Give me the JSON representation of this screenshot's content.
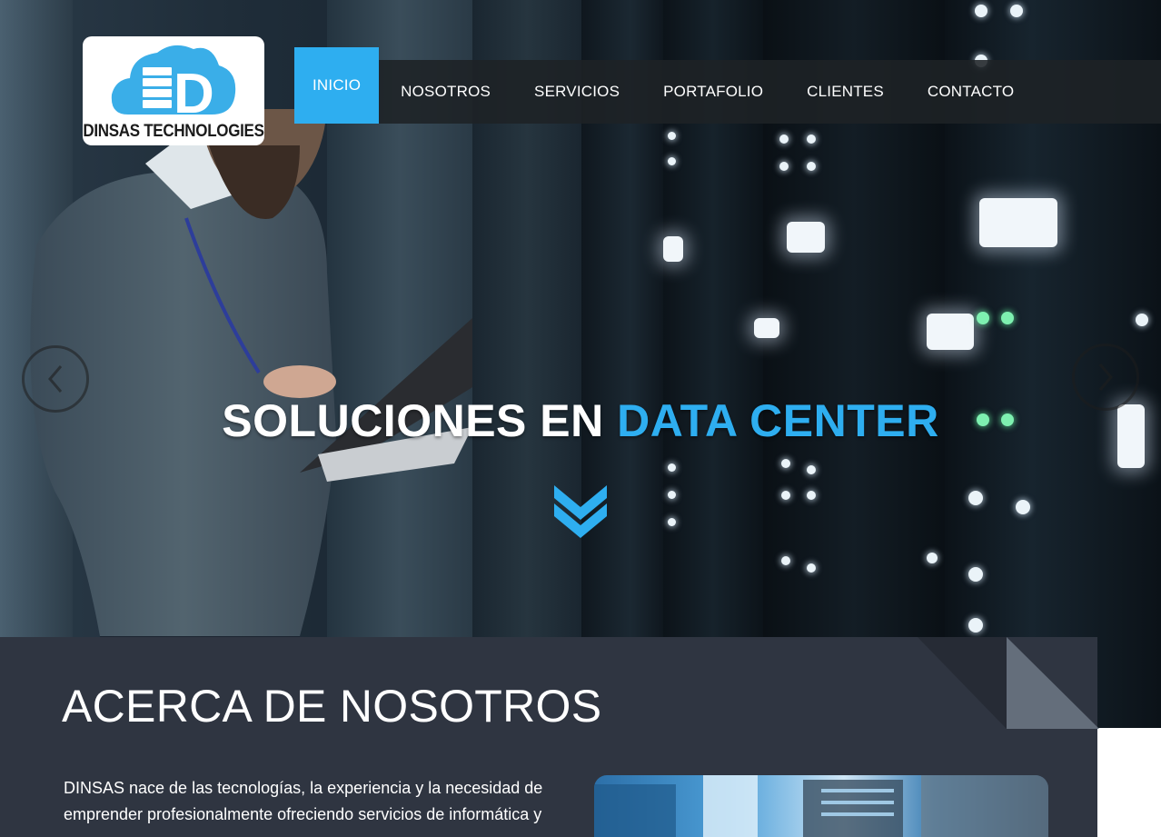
{
  "brand": {
    "logo_letter": "D",
    "name": "DINSAS TECHNOLOGIES"
  },
  "nav": {
    "items": [
      {
        "label": "INICIO",
        "active": true
      },
      {
        "label": "NOSOTROS",
        "active": false
      },
      {
        "label": "SERVICIOS",
        "active": false
      },
      {
        "label": "PORTAFOLIO",
        "active": false
      },
      {
        "label": "CLIENTES",
        "active": false
      },
      {
        "label": "CONTACTO",
        "active": false
      }
    ]
  },
  "hero": {
    "title_part1": "SOLUCIONES EN ",
    "title_part2": "DATA CENTER",
    "prev_icon": "chevron-left-icon",
    "next_icon": "chevron-right-icon",
    "scroll_icon": "double-chevron-down-icon"
  },
  "about": {
    "title": "ACERCA DE NOSOTROS",
    "text": "DINSAS nace de las tecnologías, la experiencia y la necesidad de emprender profesionalmente ofreciendo servicios de informática y"
  },
  "colors": {
    "accent": "#2eaef0",
    "nav_bg": "#1e2226",
    "about_bg": "#2f3541"
  }
}
